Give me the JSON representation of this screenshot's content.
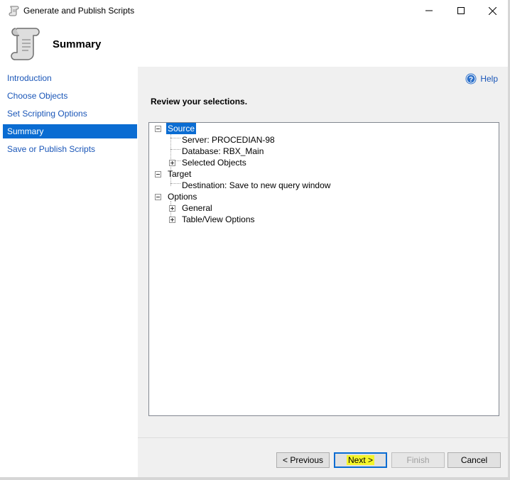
{
  "window": {
    "title": "Generate and Publish Scripts",
    "minimize_label": "Minimize",
    "maximize_label": "Maximize",
    "close_label": "Close"
  },
  "header": {
    "title": "Summary",
    "icon": "script-scroll-icon"
  },
  "sidebar": {
    "items": [
      {
        "label": "Introduction",
        "active": false
      },
      {
        "label": "Choose Objects",
        "active": false
      },
      {
        "label": "Set Scripting Options",
        "active": false
      },
      {
        "label": "Summary",
        "active": true
      },
      {
        "label": "Save or Publish Scripts",
        "active": false
      }
    ]
  },
  "main": {
    "help_label": "Help",
    "review_heading": "Review your selections."
  },
  "tree": {
    "source": {
      "label": "Source",
      "server": "Server: PROCEDIAN-98",
      "database": "Database: RBX_Main",
      "selected_objects": "Selected Objects"
    },
    "target": {
      "label": "Target",
      "destination": "Destination: Save to new query window"
    },
    "options": {
      "label": "Options",
      "general": "General",
      "table_view": "Table/View Options"
    }
  },
  "buttons": {
    "previous": "< Previous",
    "next": "Next >",
    "finish": "Finish",
    "cancel": "Cancel"
  },
  "colors": {
    "accent": "#0a6cd2",
    "link": "#1a56b8",
    "highlight": "#f4f52b"
  }
}
